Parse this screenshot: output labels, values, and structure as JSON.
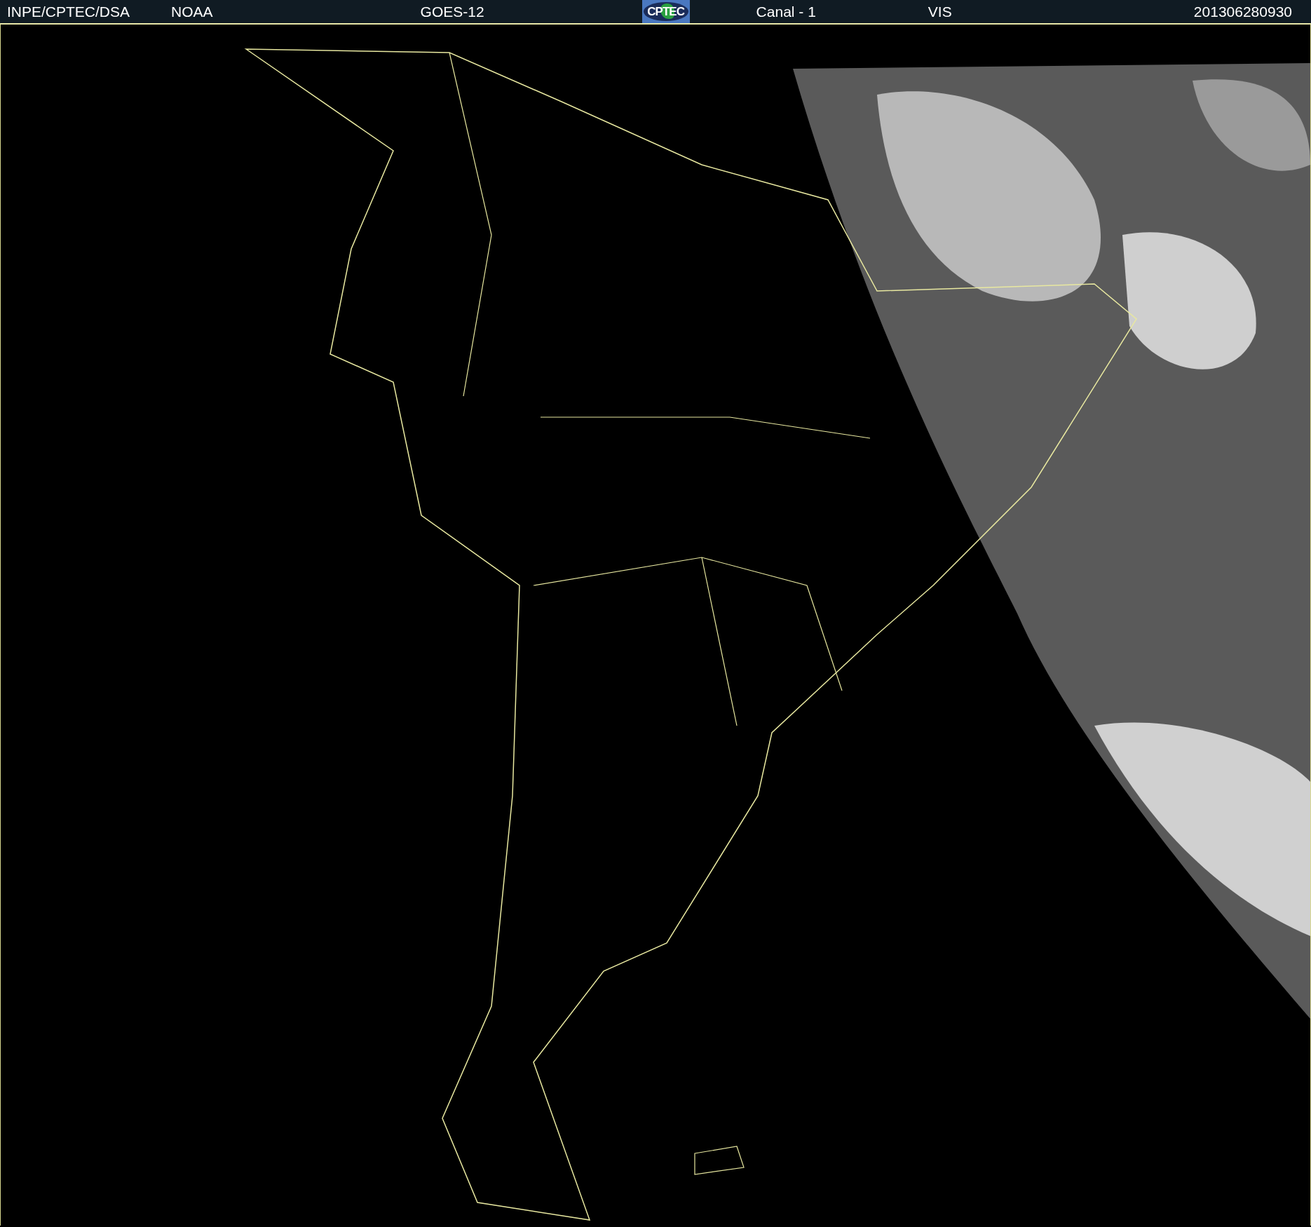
{
  "header": {
    "source": "INPE/CPTEC/DSA",
    "agency": "NOAA",
    "satellite": "GOES-12",
    "logo": "CPTEC",
    "channel": "Canal - 1",
    "band": "VIS",
    "timestamp": "201306280930"
  }
}
